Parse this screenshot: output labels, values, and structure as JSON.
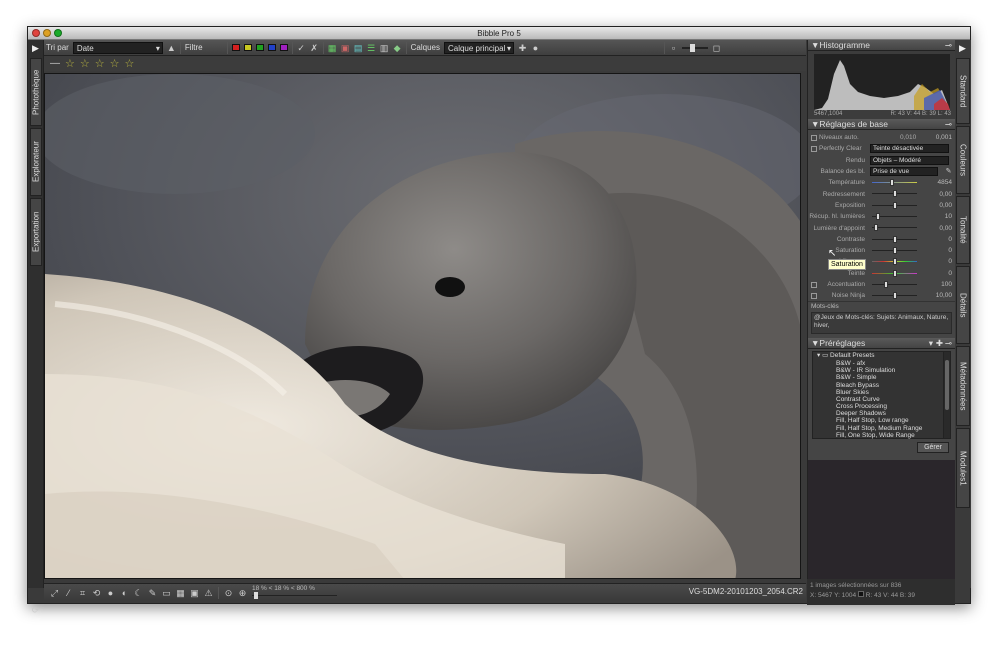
{
  "window": {
    "title": "Bibble Pro 5"
  },
  "toolbar": {
    "sort_label": "Tri par",
    "sort_value": "Date",
    "filter_label": "Filtre",
    "color_labels": [
      "#d42020",
      "#c8c820",
      "#20a020",
      "#2040c8",
      "#a020c0"
    ],
    "layers_label": "Calques",
    "layer_value": "Calque principal"
  },
  "rating": {
    "stars": 5
  },
  "left_tabs": [
    "Photothèque",
    "Explorateur",
    "Exportation"
  ],
  "bottom": {
    "zoom_text": "18 % < 18 % < 800 %",
    "filename": "VG-5DM2-20101203_2054.CR2"
  },
  "histogram": {
    "title": "Histogramme",
    "coords": "5467,1004",
    "readout": "R: 43  V: 44  B: 39  L: 43"
  },
  "basic": {
    "title": "Réglages de base",
    "niveaux_auto": {
      "label": "Niveaux auto.",
      "v1": "0,010",
      "v2": "0,001"
    },
    "perfectly_clear": {
      "label": "Perfectly Clear",
      "value": "Teinte désactivée"
    },
    "rendu": {
      "label": "Rendu",
      "value": "Objets – Modéré"
    },
    "balance": {
      "label": "Balance des bl.",
      "value": "Prise de vue"
    },
    "sliders": [
      {
        "label": "Température",
        "value": "4854"
      },
      {
        "label": "Redressement",
        "value": "0,00"
      },
      {
        "label": "Exposition",
        "value": "0,00"
      },
      {
        "label": "Récup. hl. lumières",
        "value": "10"
      },
      {
        "label": "Lumière d'appoint",
        "value": "0,00"
      },
      {
        "label": "Contraste",
        "value": "0"
      },
      {
        "label": "Saturation",
        "value": "0"
      },
      {
        "label": "Vibrance",
        "value": "0"
      },
      {
        "label": "Teinte",
        "value": "0"
      },
      {
        "label": "Accentuation",
        "value": "100"
      },
      {
        "label": "Noise Ninja",
        "value": "10,00"
      }
    ],
    "tooltip": "Saturation",
    "keywords_label": "Mots-clés",
    "keywords_text": "@Jeux de Mots-clés: Sujets: Animaux, Nature, hiver,"
  },
  "presets": {
    "title": "Préréglages",
    "group": "Default Presets",
    "items": [
      "B&W - afx",
      "B&W - IR Simulation",
      "B&W - Simple",
      "Bleach Bypass",
      "Bluer Skies",
      "Contrast Curve",
      "Cross Processing",
      "Deeper Shadows",
      "Fill, Half Stop, Low range",
      "Fill, Half Stop, Medium Range",
      "Fill, One Stop, Wide Range"
    ],
    "manage_label": "Gérer"
  },
  "right_tabs": [
    "Standard",
    "Couleurs",
    "Tonalité",
    "Détails",
    "Métadonnées",
    "Modules1"
  ],
  "status": {
    "selection": "1 images sélectionnées sur 836",
    "coords": "X: 5467  Y: 1004",
    "readout": "R: 43  V: 44  B: 39"
  }
}
